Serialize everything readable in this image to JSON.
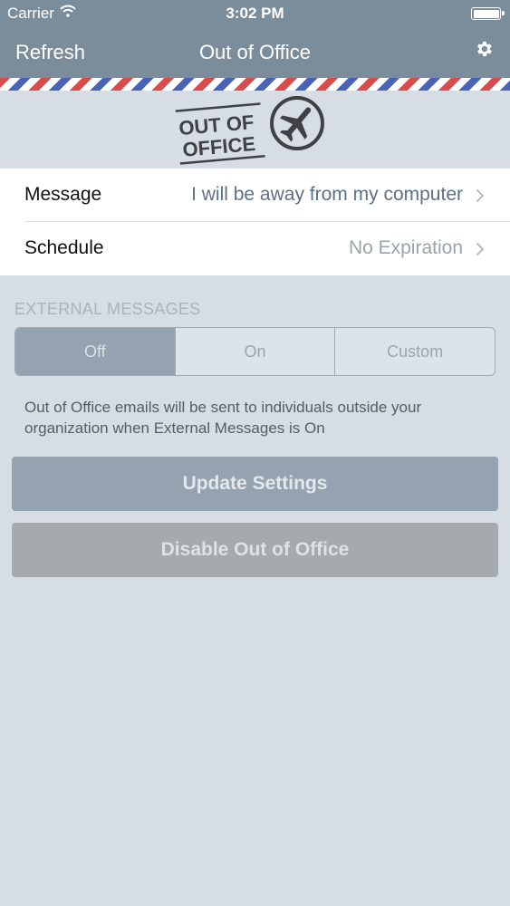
{
  "status_bar": {
    "carrier": "Carrier",
    "time": "3:02 PM",
    "icons": [
      "wifi-icon",
      "battery-icon"
    ]
  },
  "nav": {
    "left_button": "Refresh",
    "title": "Out of Office",
    "right_icon": "gear-icon"
  },
  "logo": {
    "line1": "OUT OF",
    "line2": "OFFICE",
    "icon": "airplane-icon"
  },
  "settings": {
    "message": {
      "label": "Message",
      "value": "I will be away from my computer"
    },
    "schedule": {
      "label": "Schedule",
      "value": "No Expiration"
    }
  },
  "external": {
    "header": "EXTERNAL MESSAGES",
    "options": [
      "Off",
      "On",
      "Custom"
    ],
    "selected": "Off",
    "description": "Out of Office emails will be sent to individuals outside your organization when External Messages is On"
  },
  "buttons": {
    "update": "Update Settings",
    "disable": "Disable Out of Office"
  },
  "colors": {
    "nav_bar": "#7b8c9b",
    "background": "#d6dde5",
    "accent_value": "#5d7186",
    "segment_selected": "#95a3b0",
    "stripe_red": "#d94c4c",
    "stripe_blue": "#4b63b4"
  }
}
